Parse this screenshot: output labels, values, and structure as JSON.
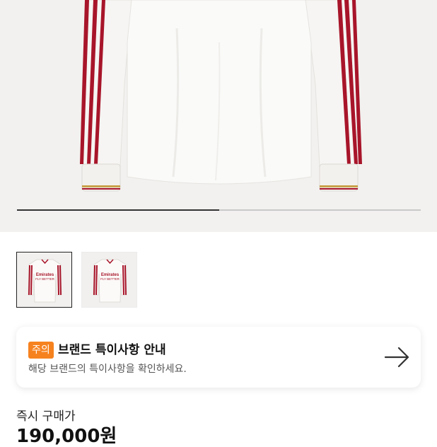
{
  "product": {
    "image_alt": "Long-sleeve white jersey with red stripes",
    "gallery_progress": 0.5
  },
  "thumbnails": [
    {
      "selected": true,
      "sponsor_text": "Emirates FLY BETTER"
    },
    {
      "selected": false,
      "sponsor_text": "Emirates FLY BETTER"
    }
  ],
  "notice": {
    "badge": "주의",
    "title": "브랜드 특이사항 안내",
    "description": "해당 브랜드의 특이사항을 확인하세요.",
    "arrow_icon": "arrow-right-icon"
  },
  "price": {
    "label": "즉시 구매가",
    "value": "190,000원"
  },
  "colors": {
    "accent": "#f6821f",
    "stripe_red": "#a8152a",
    "hero_bg": "#f2f1ef"
  }
}
